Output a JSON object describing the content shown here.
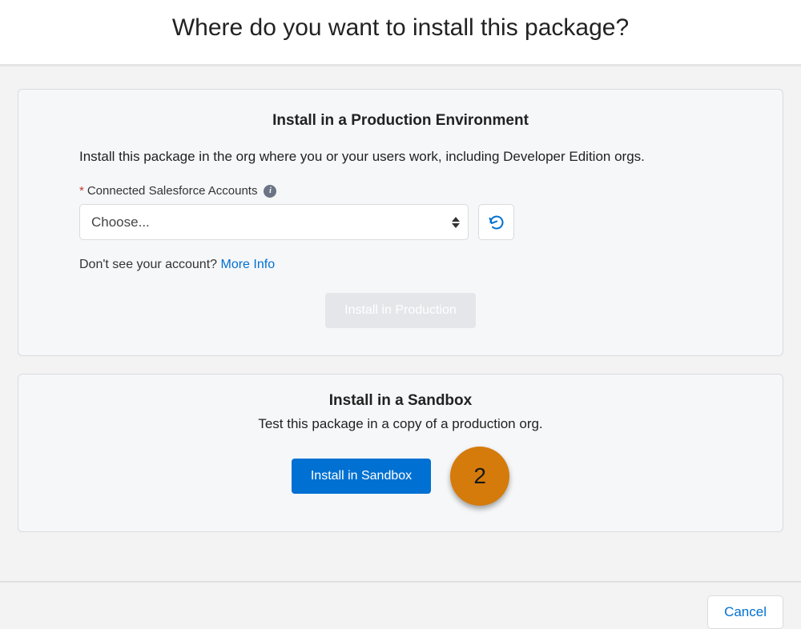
{
  "header": {
    "title": "Where do you want to install this package?"
  },
  "production": {
    "title": "Install in a Production Environment",
    "desc": "Install this package in the org where you or your users work, including Developer Edition orgs.",
    "field_label": "Connected Salesforce Accounts",
    "required_symbol": "*",
    "info_glyph": "i",
    "select_placeholder": "Choose...",
    "helper_prefix": "Don't see your account? ",
    "helper_link": "More Info",
    "button_label": "Install in Production"
  },
  "sandbox": {
    "title": "Install in a Sandbox",
    "desc": "Test this package in a copy of a production org.",
    "button_label": "Install in Sandbox",
    "callout_number": "2"
  },
  "footer": {
    "cancel": "Cancel"
  }
}
